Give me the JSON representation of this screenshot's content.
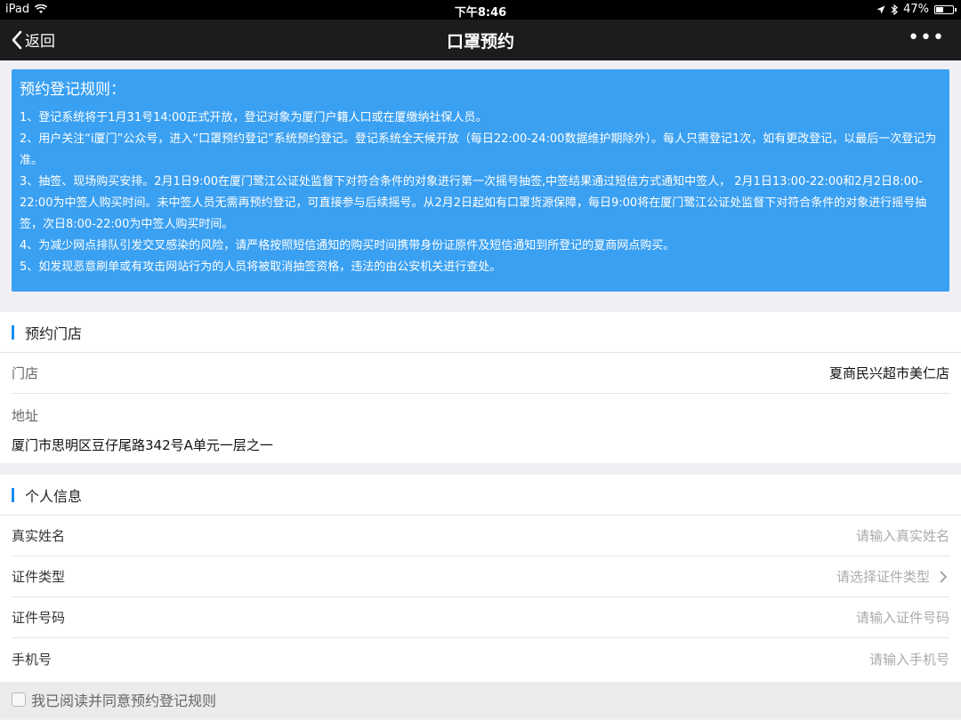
{
  "status_bar": {
    "device": "iPad",
    "time": "下午8:46",
    "battery": "47%",
    "battery_level": 0.47
  },
  "nav": {
    "back_label": "返回",
    "title": "口罩预约",
    "more": "•••"
  },
  "rules": {
    "title": "预约登记规则：",
    "items": [
      "1、登记系统将于1月31号14:00正式开放，登记对象为厦门户籍人口或在厦缴纳社保人员。",
      "2、用户关注“i厦门”公众号，进入“口罩预约登记”系统预约登记。登记系统全天候开放（每日22:00-24:00数据维护期除外）。每人只需登记1次，如有更改登记，以最后一次登记为准。",
      "3、抽签、现场购买安排。2月1日9:00在厦门鹭江公证处监督下对符合条件的对象进行第一次摇号抽签,中签结果通过短信方式通知中签人， 2月1日13:00-22:00和2月2日8:00-22:00为中签人购买时间。未中签人员无需再预约登记，可直接参与后续摇号。从2月2日起如有口罩货源保障，每日9:00将在厦门鹭江公证处监督下对符合条件的对象进行摇号抽签，次日8:00-22:00为中签人购买时间。",
      "4、为减少网点排队引发交叉感染的风险，请严格按照短信通知的购买时间携带身份证原件及短信通知到所登记的夏商网点购买。",
      "5、如发现恶意刷单或有攻击网站行为的人员将被取消抽签资格，违法的由公安机关进行查处。"
    ]
  },
  "store_section": {
    "title": "预约门店",
    "store_label": "门店",
    "store_value": "夏商民兴超市美仁店",
    "address_label": "地址",
    "address_value": "厦门市思明区豆仔尾路342号A单元一层之一"
  },
  "personal_section": {
    "title": "个人信息",
    "name_label": "真实姓名",
    "name_placeholder": "请输入真实姓名",
    "id_type_label": "证件类型",
    "id_type_placeholder": "请选择证件类型",
    "id_number_label": "证件号码",
    "id_number_placeholder": "请输入证件号码",
    "phone_label": "手机号",
    "phone_placeholder": "请输入手机号"
  },
  "agreement": {
    "label": "我已阅读并同意预约登记规则",
    "checked": false
  },
  "colors": {
    "rules_background": "#3aa0f2",
    "accent_bar": "#1a8cf0",
    "nav_background": "#1c1c1e"
  }
}
